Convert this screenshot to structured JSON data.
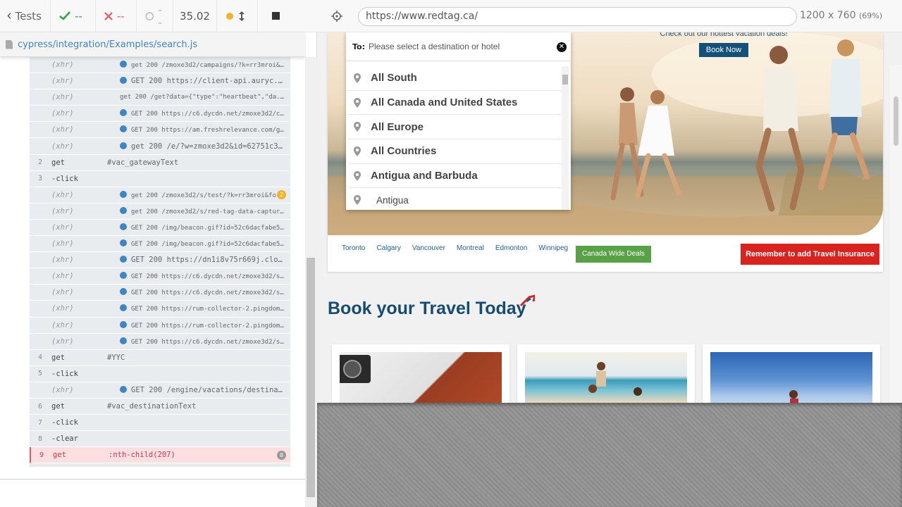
{
  "runner": {
    "back_label": "Tests",
    "passed": "--",
    "failed": "--",
    "pending": "--",
    "duration": "35.02",
    "spec_path": "cypress/integration/Examples/search.js"
  },
  "commands": [
    {
      "num": "",
      "name": "(xhr)",
      "msg": "get 200 /zmoxe3d2/campaigns/?k=rr3mroi&d=...",
      "dot": true,
      "xhr": true,
      "small": true
    },
    {
      "num": "",
      "name": "(xhr)",
      "msg": "GET 200 https://client-api.auryc.c...",
      "dot": true,
      "xhr": true
    },
    {
      "num": "",
      "name": "(xhr)",
      "msg": "get 200 /get?data={\"type\":\"heartbeat\",\"da...",
      "dot": false,
      "xhr": true,
      "small": true
    },
    {
      "num": "",
      "name": "(xhr)",
      "msg": "GET 200 https://c6.dycdn.net/zmoxe3d2/cam...",
      "dot": true,
      "xhr": true,
      "small": true
    },
    {
      "num": "",
      "name": "(xhr)",
      "msg": "GET 200 https://am.freshrelevance.com/get...",
      "dot": true,
      "xhr": true,
      "small": true
    },
    {
      "num": "",
      "name": "(xhr)",
      "msg": "get 200 /e/?w=zmoxe3d2&id=62751c32...",
      "dot": true,
      "xhr": true
    },
    {
      "num": "2",
      "name": "get",
      "msg": "#vac_gatewayText",
      "dot": false,
      "xhr": false
    },
    {
      "num": "3",
      "name": " -click",
      "msg": "",
      "dot": false,
      "xhr": false
    },
    {
      "num": "",
      "name": "(xhr)",
      "msg": "get 200 /zmoxe3d2/s/test/?k=rr3mroi&form...",
      "dot": true,
      "xhr": true,
      "small": true,
      "badge": "2"
    },
    {
      "num": "",
      "name": "(xhr)",
      "msg": "get 200 /zmoxe3d2/s/red-tag-data-capture/...",
      "dot": true,
      "xhr": true,
      "small": true
    },
    {
      "num": "",
      "name": "(xhr)",
      "msg": "GET 200 /img/beacon.gif?id=52c6dacfabe53d...",
      "dot": true,
      "xhr": true,
      "small": true
    },
    {
      "num": "",
      "name": "(xhr)",
      "msg": "GET 200 /img/beacon.gif?id=52c6dacfabe53d...",
      "dot": true,
      "xhr": true,
      "small": true
    },
    {
      "num": "",
      "name": "(xhr)",
      "msg": "GET 200 https://dn1i8v75r669j.clou...",
      "dot": true,
      "xhr": true
    },
    {
      "num": "",
      "name": "(xhr)",
      "msg": "GET 200 https://c6.dycdn.net/zmoxe3d2/s/t...",
      "dot": true,
      "xhr": true,
      "small": true
    },
    {
      "num": "",
      "name": "(xhr)",
      "msg": "GET 200 https://c6.dycdn.net/zmoxe3d2/s/r...",
      "dot": true,
      "xhr": true,
      "small": true
    },
    {
      "num": "",
      "name": "(xhr)",
      "msg": "GET 200 https://rum-collector-2.pingdom.n...",
      "dot": true,
      "xhr": true,
      "small": true
    },
    {
      "num": "",
      "name": "(xhr)",
      "msg": "GET 200 https://rum-collector-2.pingdom.n...",
      "dot": true,
      "xhr": true,
      "small": true
    },
    {
      "num": "",
      "name": "(xhr)",
      "msg": "GET 200 https://c6.dycdn.net/zmoxe3d2/s/t...",
      "dot": true,
      "xhr": true,
      "small": true
    },
    {
      "num": "4",
      "name": "get",
      "msg": "#YYC",
      "dot": false,
      "xhr": false
    },
    {
      "num": "5",
      "name": " -click",
      "msg": "",
      "dot": false,
      "xhr": false
    },
    {
      "num": "",
      "name": "(xhr)",
      "msg": "GET 200 /engine/vacations/destinat...",
      "dot": true,
      "xhr": true
    },
    {
      "num": "6",
      "name": "get",
      "msg": "#vac_destinationText",
      "dot": false,
      "xhr": false
    },
    {
      "num": "7",
      "name": " -click",
      "msg": "",
      "dot": false,
      "xhr": false
    },
    {
      "num": "8",
      "name": " -clear",
      "msg": "",
      "dot": false,
      "xhr": false
    },
    {
      "num": "9",
      "name": "get",
      "msg": ":nth-child(207)",
      "dot": false,
      "xhr": false,
      "error": true,
      "badge": "0"
    }
  ],
  "aut": {
    "url": "https://www.redtag.ca/",
    "viewport": "1200 x 760",
    "scale": "(69%)"
  },
  "site": {
    "to_label": "To:",
    "dest_placeholder": "Please select a destination or hotel",
    "destinations": [
      {
        "label": "All South",
        "sub": false
      },
      {
        "label": "All Canada and United States",
        "sub": false
      },
      {
        "label": "All Europe",
        "sub": false
      },
      {
        "label": "All Countries",
        "sub": false
      },
      {
        "label": "Antigua and Barbuda",
        "sub": false
      },
      {
        "label": "Antigua",
        "sub": true
      }
    ],
    "promo_text": "Check out our hottest vacation deals!",
    "book_now": "Book Now",
    "cities": [
      "Toronto",
      "Calgary",
      "Vancouver",
      "Montreal",
      "Edmonton",
      "Winnipeg"
    ],
    "canada_deals": "Canada Wide Deals",
    "insurance": "Remember to add Travel Insurance",
    "section_title": "Book your Travel Today"
  },
  "colors": {
    "accent_blue": "#3f84c4",
    "error": "#c23d4b",
    "brand_navy": "#164b72",
    "brand_red": "#d8231f",
    "deal_green": "#58a146"
  }
}
